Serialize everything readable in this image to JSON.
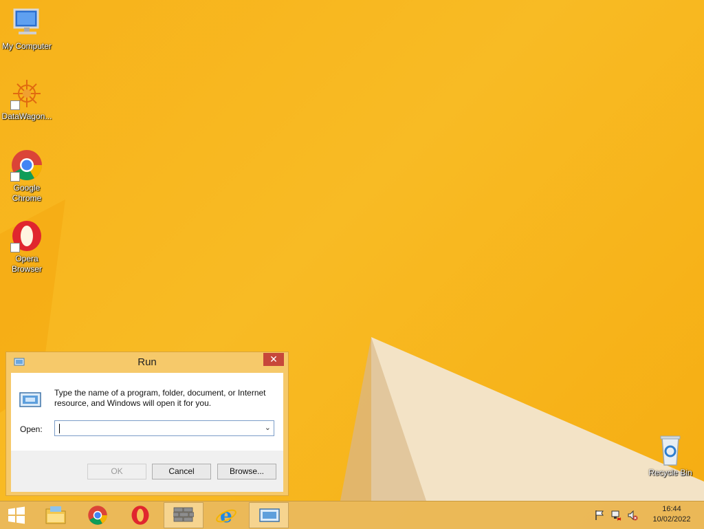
{
  "desktop": {
    "icons": [
      {
        "label": "My Computer",
        "icon": "computer-icon"
      },
      {
        "label": "DataWagon...",
        "icon": "datawagon-icon"
      },
      {
        "label": "Google Chrome",
        "icon": "chrome-icon"
      },
      {
        "label": "Opera Browser",
        "icon": "opera-icon"
      },
      {
        "label": "Recycle Bin",
        "icon": "recycle-bin-icon"
      }
    ]
  },
  "run_dialog": {
    "title": "Run",
    "close_label": "✕",
    "description": "Type the name of a program, folder, document, or Internet resource, and Windows will open it for you.",
    "open_label": "Open:",
    "open_value": "",
    "ok_label": "OK",
    "cancel_label": "Cancel",
    "browse_label": "Browse..."
  },
  "taskbar": {
    "items": [
      {
        "name": "start",
        "icon": "windows-logo-icon"
      },
      {
        "name": "file-explorer",
        "icon": "folder-icon"
      },
      {
        "name": "chrome",
        "icon": "chrome-icon"
      },
      {
        "name": "opera",
        "icon": "opera-icon"
      },
      {
        "name": "firewall",
        "icon": "brick-wall-icon",
        "active": true
      },
      {
        "name": "internet-explorer",
        "icon": "ie-icon"
      },
      {
        "name": "run",
        "icon": "run-icon",
        "active": true
      }
    ],
    "tray": [
      "flag-icon",
      "network-icon",
      "volume-muted-icon"
    ],
    "time": "16:44",
    "date": "10/02/2022"
  },
  "colors": {
    "wallpaper": "#f7b21a",
    "dialog_frame": "#f6c96a",
    "close_button": "#c7473a"
  }
}
